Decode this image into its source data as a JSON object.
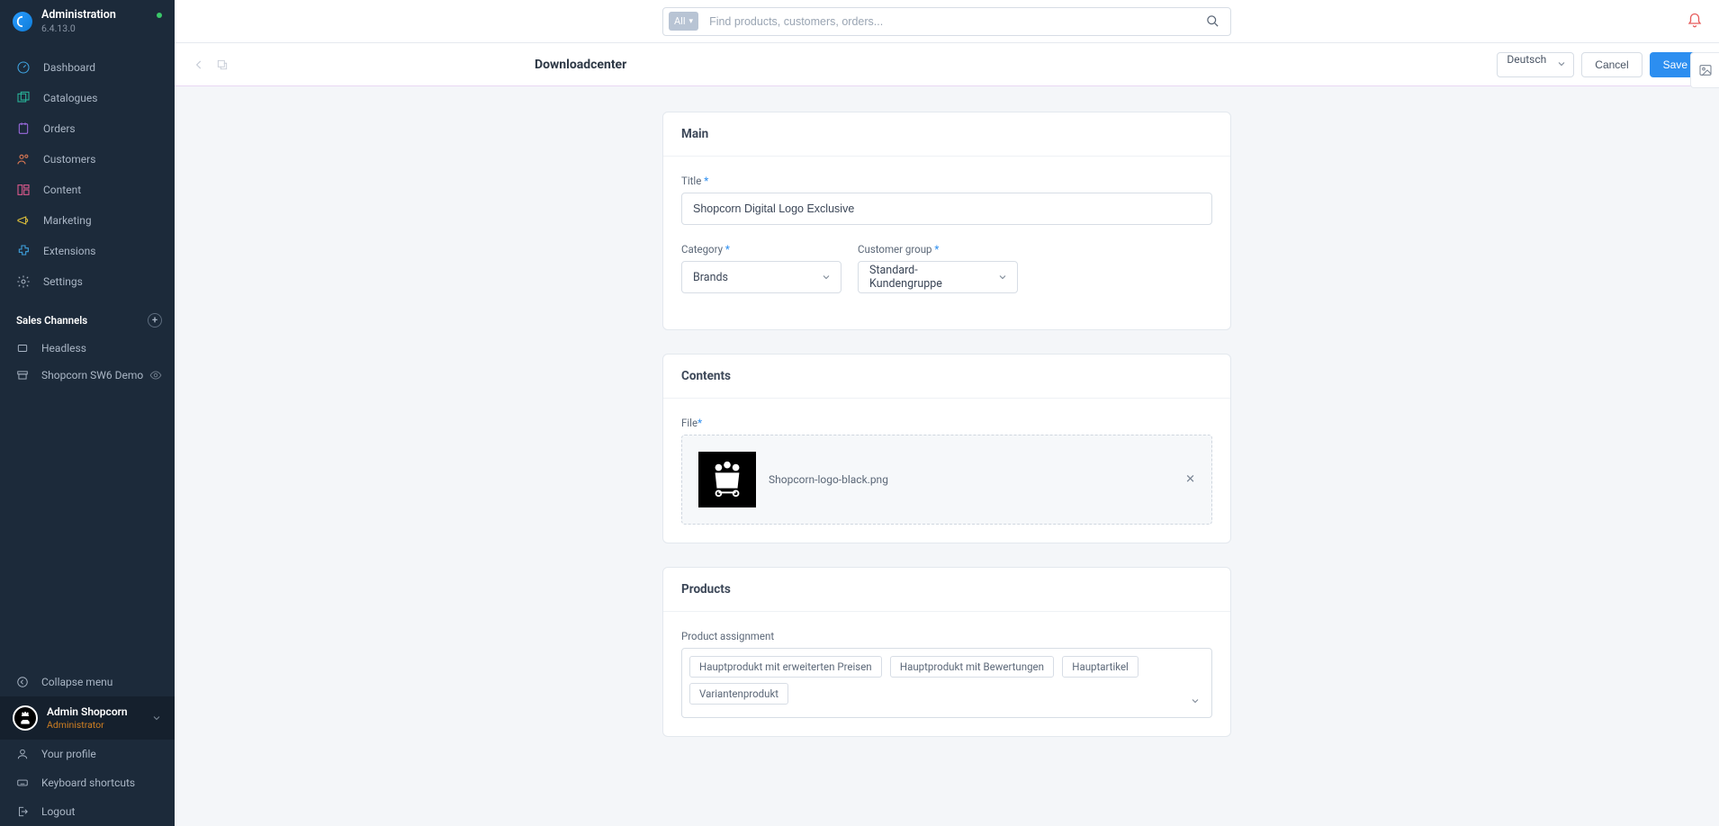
{
  "brand": {
    "title": "Administration",
    "version": "6.4.13.0"
  },
  "nav": {
    "dashboard": "Dashboard",
    "catalogues": "Catalogues",
    "orders": "Orders",
    "customers": "Customers",
    "content": "Content",
    "marketing": "Marketing",
    "extensions": "Extensions",
    "settings": "Settings"
  },
  "sales_channels": {
    "header": "Sales Channels",
    "items": [
      "Headless",
      "Shopcorn SW6 Demo"
    ]
  },
  "footer": {
    "collapse": "Collapse menu",
    "profile": "Your profile",
    "shortcuts": "Keyboard shortcuts",
    "logout": "Logout"
  },
  "user": {
    "name": "Admin Shopcorn",
    "role": "Administrator"
  },
  "topbar": {
    "scope": "All",
    "search_placeholder": "Find products, customers, orders..."
  },
  "page": {
    "title": "Downloadcenter",
    "language": "Deutsch",
    "cancel": "Cancel",
    "save": "Save"
  },
  "cards": {
    "main": {
      "title": "Main",
      "title_label": "Title",
      "title_value": "Shopcorn Digital Logo Exclusive",
      "category_label": "Category",
      "category_value": "Brands",
      "cgroup_label": "Customer group",
      "cgroup_value": "Standard-Kundengruppe"
    },
    "contents": {
      "title": "Contents",
      "file_label": "File",
      "file_name": "Shopcorn-logo-black.png"
    },
    "products": {
      "title": "Products",
      "assign_label": "Product assignment",
      "tags": [
        "Hauptprodukt mit erweiterten Preisen",
        "Hauptprodukt mit Bewertungen",
        "Hauptartikel",
        "Variantenprodukt"
      ]
    }
  }
}
